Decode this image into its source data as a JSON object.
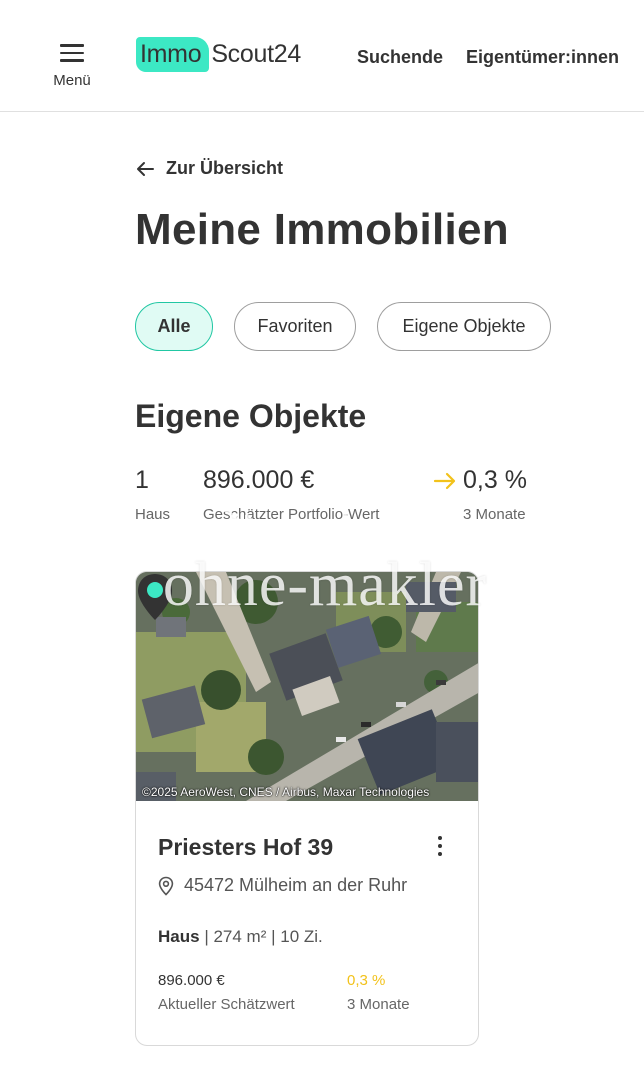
{
  "header": {
    "menu_label": "Menü",
    "logo": {
      "part1": "Immo",
      "part2": "Scout24",
      "accent_color": "#3ce8c4"
    },
    "nav": [
      {
        "label": "Suchende"
      },
      {
        "label": "Eigentümer:innen"
      }
    ]
  },
  "back_link": {
    "label": "Zur Übersicht",
    "icon": "arrow-left-icon"
  },
  "page_title": "Meine Immobilien",
  "filters": [
    {
      "label": "Alle",
      "active": true
    },
    {
      "label": "Favoriten",
      "active": false
    },
    {
      "label": "Eigene Objekte",
      "active": false
    }
  ],
  "section_title": "Eigene Objekte",
  "stats": {
    "count": {
      "value": "1",
      "label": "Haus"
    },
    "portfolio": {
      "value": "896.000 €",
      "label": "Geschätzter Portfolio-Wert"
    },
    "trend": {
      "value": "0,3 %",
      "label": "3 Monate",
      "icon": "arrow-right-icon",
      "color": "#f2c21b"
    }
  },
  "property": {
    "map_credit": "©2025 AeroWest, CNES / Airbus, Maxar Technologies",
    "title": "Priesters Hof 39",
    "address": "45472 Mülheim an der Ruhr",
    "type": "Haus",
    "area": "274 m²",
    "rooms": "10 Zi.",
    "value": {
      "amount": "896.000 €",
      "label": "Aktueller Schätzwert"
    },
    "trend": {
      "value": "0,3 %",
      "label": "3 Monate",
      "color": "#f2c21b"
    },
    "pin_color": "#3ce8c4"
  },
  "watermark": "ohne-makler"
}
